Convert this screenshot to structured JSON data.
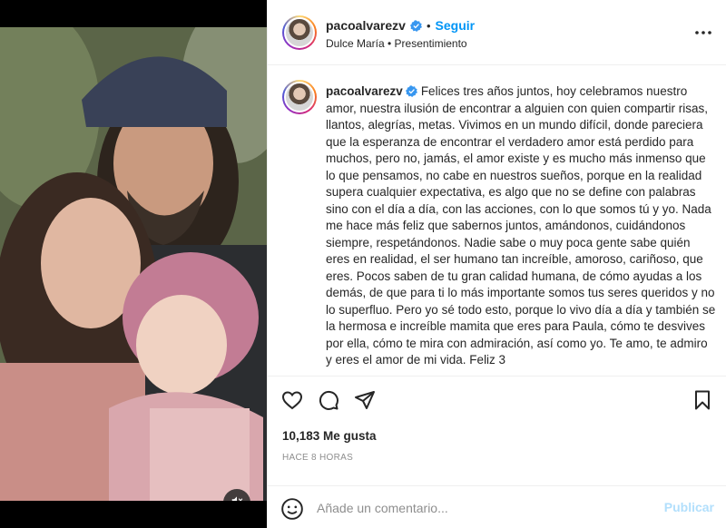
{
  "post": {
    "media": {
      "mute_icon": "speaker-muted-icon"
    },
    "header": {
      "username": "pacoalvarezv",
      "separator": "•",
      "follow_label": "Seguir",
      "song": "Dulce María • Presentimiento",
      "more_icon": "more-horizontal-icon"
    },
    "caption": {
      "username": "pacoalvarezv",
      "text": "Felices tres años juntos, hoy celebramos nuestro amor, nuestra ilusión de encontrar a alguien con quien compartir risas, llantos, alegrías, metas. Vivimos en un mundo difícil, donde pareciera que la esperanza de encontrar el verdadero amor está perdido para muchos, pero no, jamás, el amor existe y es mucho más inmenso que lo que pensamos, no cabe en nuestros sueños, porque en la realidad supera cualquier expectativa, es algo que no se define con palabras sino con el día a día, con las acciones, con lo que somos tú y yo. Nada me hace más feliz que sabernos juntos, amándonos, cuidándonos siempre, respetándonos. Nadie sabe o muy poca gente sabe quién eres en realidad, el ser humano tan increíble, amoroso, cariñoso, que eres. Pocos saben de tu gran calidad humana, de cómo ayudas a los demás, de que para ti lo más importante somos tus seres queridos y no lo superfluo. Pero yo sé todo esto, porque lo vivo día a día y también se la hermosa e increíble mamita que eres para Paula, cómo te desvives por ella, cómo te mira con admiración, así como yo. Te amo, te admiro y eres el amor de mi vida. Feliz 3"
    },
    "actions": {
      "like_icon": "heart-icon",
      "comment_icon": "comment-icon",
      "share_icon": "send-icon",
      "save_icon": "bookmark-icon"
    },
    "likes": "10,183 Me gusta",
    "timestamp": "HACE 8 HORAS",
    "comment_box": {
      "emoji_icon": "emoji-icon",
      "placeholder": "Añade un comentario...",
      "publish_label": "Publicar"
    },
    "colors": {
      "accent": "#0095f6",
      "publish_disabled": "#b2dffc",
      "secondary_text": "#8e8e8e",
      "border": "#efefef"
    }
  }
}
